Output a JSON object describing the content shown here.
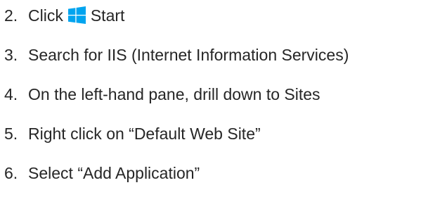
{
  "steps": [
    {
      "number": "2.",
      "text_before_icon": "Click",
      "icon": "windows-start-icon",
      "text_after_icon": "Start"
    },
    {
      "number": "3.",
      "text": "Search for IIS (Internet Information Services)"
    },
    {
      "number": "4.",
      "text": "On the left-hand pane, drill down to Sites"
    },
    {
      "number": "5.",
      "text": "Right click on “Default Web Site”"
    },
    {
      "number": "6.",
      "text": "Select “Add Application”"
    }
  ],
  "colors": {
    "text": "#262626",
    "windows_icon": "#00A4EF"
  }
}
